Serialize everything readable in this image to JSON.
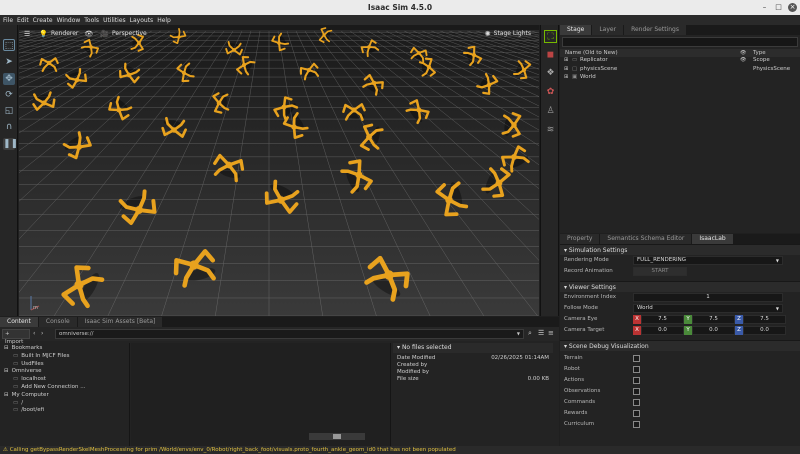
{
  "window": {
    "title": "Isaac Sim 4.5.0"
  },
  "menu": [
    "File",
    "Edit",
    "Create",
    "Window",
    "Tools",
    "Utilities",
    "Layouts",
    "Help"
  ],
  "viewport": {
    "renderer_label": "Renderer",
    "camera_label": "Perspective",
    "lights_label": "Stage Lights",
    "axis_label": "m"
  },
  "stage": {
    "tabs": [
      "Stage",
      "Layer",
      "Render Settings"
    ],
    "col_name": "Name (Old to New)",
    "col_type": "Type",
    "items": [
      {
        "name": "Replicator",
        "type": "Scope"
      },
      {
        "name": "physicsScene",
        "type": "PhysicsScene"
      },
      {
        "name": "World",
        "type": ""
      }
    ]
  },
  "properties": {
    "tabs": [
      "Property",
      "Semantics Schema Editor",
      "IsaacLab"
    ],
    "simulation": {
      "title": "Simulation Settings",
      "rendering_mode_label": "Rendering Mode",
      "rendering_mode_value": "FULL_RENDERING",
      "record_label": "Record Animation",
      "record_button": "START"
    },
    "viewer": {
      "title": "Viewer Settings",
      "env_index_label": "Environment Index",
      "env_index_value": "1",
      "follow_mode_label": "Follow Mode",
      "follow_mode_value": "World",
      "camera_eye_label": "Camera Eye",
      "camera_eye": [
        "7.5",
        "7.5",
        "7.5"
      ],
      "camera_target_label": "Camera Target",
      "camera_target": [
        "0.0",
        "0.0",
        "0.0"
      ],
      "axes": [
        "X",
        "Y",
        "Z"
      ]
    },
    "debug": {
      "title": "Scene Debug Visualization",
      "items": [
        "Terrain",
        "Robot",
        "Actions",
        "Observations",
        "Commands",
        "Rewards",
        "Curriculum"
      ]
    }
  },
  "content": {
    "tabs": [
      "Content",
      "Console",
      "Isaac Sim Assets [Beta]"
    ],
    "import_label": "Import",
    "path": "omniverse://",
    "tree": [
      {
        "label": "Bookmarks",
        "level": 0
      },
      {
        "label": "Built In MJCF Files",
        "level": 1
      },
      {
        "label": "UsdFiles",
        "level": 1
      },
      {
        "label": "Omniverse",
        "level": 0
      },
      {
        "label": "localhost",
        "level": 1
      },
      {
        "label": "Add New Connection ...",
        "level": 1
      },
      {
        "label": "My Computer",
        "level": 0
      },
      {
        "label": "/",
        "level": 1
      },
      {
        "label": "/boot/efi",
        "level": 1
      }
    ],
    "details": {
      "title": "No files selected",
      "date_label": "Date Modified",
      "date_value": "02/26/2025 01:14AM",
      "created_label": "Created by",
      "modified_label": "Modified by",
      "size_label": "File size",
      "size_value": "0.00 KB"
    }
  },
  "status": {
    "message": "Calling getBypassRenderSkelMeshProcessing for prim /World/envs/env_0/Robot/right_back_foot/visuals.proto_fourth_ankle_geom_id0 that has not been populated"
  },
  "colors": {
    "robot": "#e8a21e",
    "accent": "#76b900",
    "panel": "#232323"
  }
}
